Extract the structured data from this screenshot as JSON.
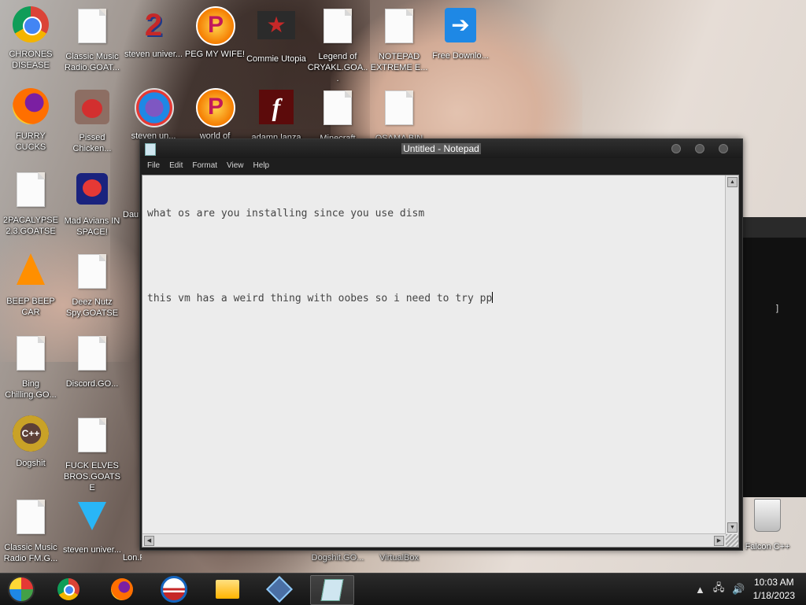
{
  "desktop": {
    "icons": [
      {
        "label": "CHRONES DISEASE",
        "icon": "chrome-icon"
      },
      {
        "label": "Classic Music Radio.GOAT...",
        "icon": "document-icon"
      },
      {
        "label": "steven univer...",
        "icon": "app-2-icon"
      },
      {
        "label": "PEG MY WIFE!",
        "icon": "peggle-icon"
      },
      {
        "label": "Commie Utopia",
        "icon": "star-icon"
      },
      {
        "label": "Legend of CRYAKL.GOA...",
        "icon": "document-icon"
      },
      {
        "label": "NOTEPAD EXTREME E...",
        "icon": "document-icon"
      },
      {
        "label": "Free Downlo...",
        "icon": "download-icon"
      },
      {
        "label": "FURRY CUCKS",
        "icon": "firefox-icon"
      },
      {
        "label": "Pissed Chicken...",
        "icon": "angry-birds-seasons-icon"
      },
      {
        "label": "steven un...",
        "icon": "gem-icon"
      },
      {
        "label": "world of",
        "icon": "peggle-icon"
      },
      {
        "label": "adamn lanza",
        "icon": "flash-icon"
      },
      {
        "label": "Minecraft",
        "icon": "document-icon"
      },
      {
        "label": "OSAMA BIN",
        "icon": "document-icon"
      },
      {
        "label": "2PACALYPSE 2.3.GOATSE",
        "icon": "document-icon"
      },
      {
        "label": "Mad Avians IN SPACE!",
        "icon": "angry-birds-space-icon"
      },
      {
        "label": "Dau",
        "icon": "document-icon"
      },
      {
        "label": "BEEP BEEP CAR",
        "icon": "vlc-icon"
      },
      {
        "label": "Deez Nutz Spy.GOATSE",
        "icon": "document-icon"
      },
      {
        "label": "Bing Chilling.GO...",
        "icon": "document-icon"
      },
      {
        "label": "Discord.GO...",
        "icon": "document-icon"
      },
      {
        "label": "Dogshit",
        "icon": "cpp-icon"
      },
      {
        "label": "FUCK ELVES BROS.GOATSE",
        "icon": "document-icon"
      },
      {
        "label": "Classic Music Radio FM.G...",
        "icon": "document-icon"
      },
      {
        "label": "steven univer...",
        "icon": "diamond-icon"
      },
      {
        "label": "Falcon C++",
        "icon": "recycle-bin-icon"
      }
    ],
    "hidden_labels": [
      "Dogshit.GO...",
      "VirtualBox",
      "Lon.For..."
    ]
  },
  "notepad": {
    "title": "Untitled - Notepad",
    "menu": [
      "File",
      "Edit",
      "Format",
      "View",
      "Help"
    ],
    "line1": "what os are you installing since you use dism",
    "line2": "",
    "line3": "this vm has a weird thing with oobes so i need to try pp"
  },
  "background_window": {
    "text": "]"
  },
  "taskbar": {
    "apps": [
      "start-orb-icon",
      "chrome-icon",
      "firefox-icon",
      "obama-icon",
      "file-explorer-icon",
      "tool-icon",
      "notepad-icon"
    ],
    "time": "10:03 AM",
    "date": "1/18/2023"
  }
}
